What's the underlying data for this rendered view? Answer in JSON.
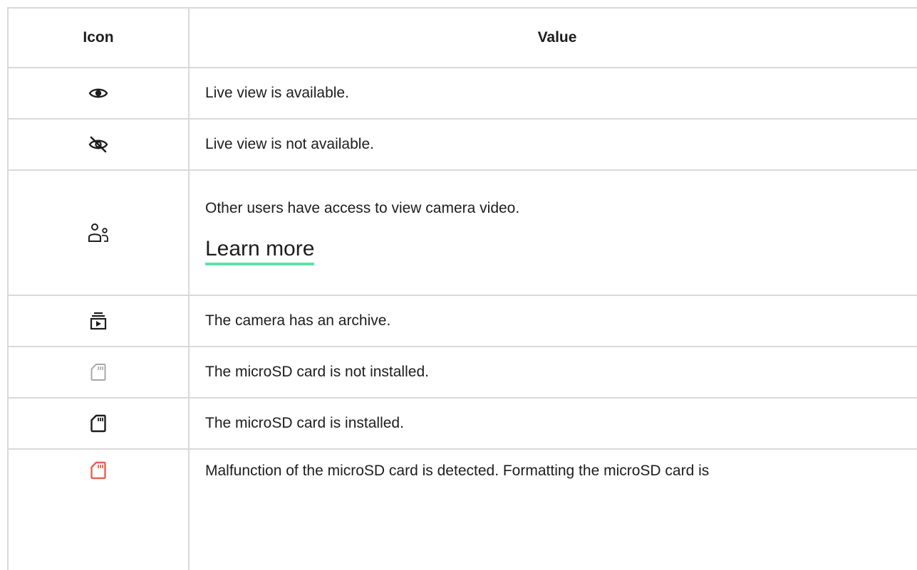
{
  "table": {
    "headers": {
      "icon": "Icon",
      "value": "Value"
    },
    "rows": [
      {
        "icon": "eye-icon",
        "text": "Live view is available."
      },
      {
        "icon": "eye-off-icon",
        "text": "Live view is not available."
      },
      {
        "icon": "users-icon",
        "text": "Other users have access to view camera video.",
        "link": "Learn more"
      },
      {
        "icon": "archive-icon",
        "text": "The camera has an archive."
      },
      {
        "icon": "sd-card-icon",
        "text": "The microSD card is not installed.",
        "color": "#a8a8a8"
      },
      {
        "icon": "sd-card-icon",
        "text": "The microSD card is installed.",
        "color": "#1d1d1d"
      },
      {
        "icon": "sd-card-icon",
        "text": "Malfunction of the microSD card is detected. Formatting the microSD card is",
        "color": "#e5614f"
      }
    ]
  },
  "colors": {
    "text": "#1d1d1d",
    "border": "#d9d9d9",
    "link_underline": "#5fe1a6"
  }
}
